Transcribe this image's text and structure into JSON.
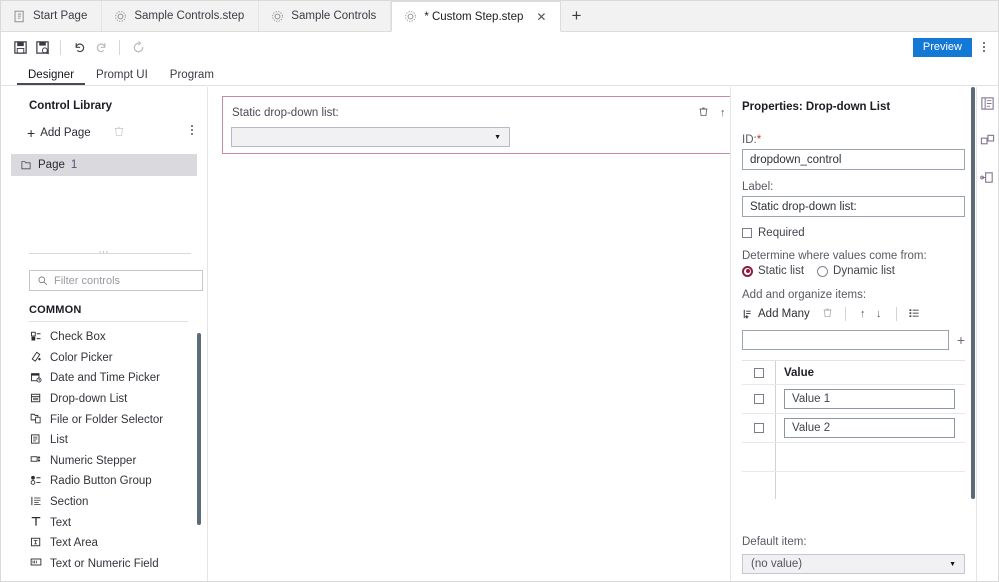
{
  "tabs": [
    {
      "label": "Start Page",
      "icon": "document-icon",
      "active": false,
      "closable": false
    },
    {
      "label": "Sample Controls.step",
      "icon": "gear-icon",
      "active": false,
      "closable": false
    },
    {
      "label": "Sample Controls",
      "icon": "gear-icon",
      "active": false,
      "closable": false
    },
    {
      "label": "* Custom Step.step",
      "icon": "gear-icon",
      "active": true,
      "closable": true
    }
  ],
  "tab_new_label": "+",
  "toolbar": {
    "save_label": "save-icon",
    "save_as_label": "save-as-icon",
    "undo_label": "undo-icon",
    "redo_label": "redo-icon",
    "refresh_label": "refresh-icon",
    "preview_label": "Preview",
    "accent_color": "#1479d4"
  },
  "subtabs": [
    {
      "label": "Designer",
      "active": true
    },
    {
      "label": "Prompt UI",
      "active": false
    },
    {
      "label": "Program",
      "active": false
    }
  ],
  "left_panel": {
    "title": "Control Library",
    "add_page_label": "Add Page",
    "pages": [
      {
        "label": "Page",
        "number": "1"
      }
    ],
    "filter_placeholder": "Filter controls",
    "section_header": "COMMON",
    "controls": [
      {
        "label": "Check Box",
        "glyph": "☰"
      },
      {
        "label": "Color Picker",
        "glyph": "✐"
      },
      {
        "label": "Date and Time Picker",
        "glyph": "Ὄ5"
      },
      {
        "label": "Drop-down List",
        "glyph": "▤"
      },
      {
        "label": "File or Folder Selector",
        "glyph": "❐"
      },
      {
        "label": "List",
        "glyph": "≣"
      },
      {
        "label": "Numeric Stepper",
        "glyph": "⇅"
      },
      {
        "label": "Radio Button Group",
        "glyph": "⊙"
      },
      {
        "label": "Section",
        "glyph": "≡"
      },
      {
        "label": "Text",
        "glyph": "T"
      },
      {
        "label": "Text Area",
        "glyph": "▣"
      },
      {
        "label": "Text or Numeric Field",
        "glyph": "▥"
      }
    ]
  },
  "canvas": {
    "control": {
      "label": "Static drop-down list:",
      "value": "",
      "selection_color": "#c98aa6",
      "tools": [
        {
          "name": "delete",
          "glyph": "🗑"
        },
        {
          "name": "move-up",
          "glyph": "↑"
        },
        {
          "name": "move-down",
          "glyph": "↓"
        }
      ]
    }
  },
  "properties": {
    "title": "Properties: Drop-down List",
    "id_label": "ID:",
    "id_required_mark": "*",
    "id_value": "dropdown_control",
    "label_label": "Label:",
    "label_value": "Static drop-down list:",
    "required_label": "Required",
    "required_checked": false,
    "source_label": "Determine where values come from:",
    "source_options": [
      {
        "label": "Static list",
        "selected": true
      },
      {
        "label": "Dynamic list",
        "selected": false
      }
    ],
    "selected_radio_color": "#8c1d41",
    "organize_label": "Add and organize items:",
    "add_many_label": "Add Many",
    "item_tools": [
      {
        "name": "delete-item",
        "glyph": "🗑"
      },
      {
        "name": "move-item-up",
        "glyph": "↑"
      },
      {
        "name": "move-item-down",
        "glyph": "↓"
      },
      {
        "name": "list-options",
        "glyph": "☷"
      }
    ],
    "new_item_value": "",
    "add_item_glyph": "+",
    "table": {
      "columns": [
        "Value"
      ],
      "rows": [
        {
          "checked": false,
          "value": "Value 1"
        },
        {
          "checked": false,
          "value": "Value 2"
        }
      ]
    },
    "default_item_label": "Default item:",
    "default_item_value": "(no value)"
  },
  "rail": [
    {
      "name": "properties-panel-icon"
    },
    {
      "name": "data-bindings-icon"
    },
    {
      "name": "layout-icon"
    }
  ]
}
